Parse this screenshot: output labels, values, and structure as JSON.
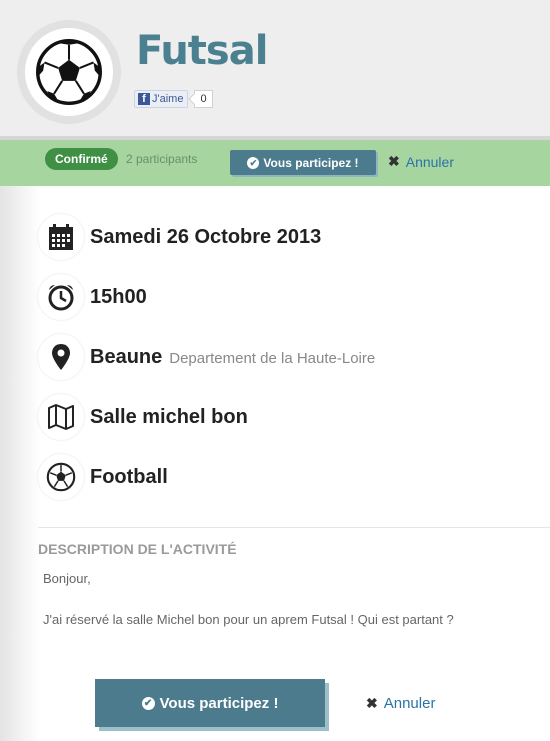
{
  "header": {
    "title": "Futsal",
    "logo_icon": "soccer-ball-icon",
    "facebook": {
      "like_label": "J'aime",
      "like_count": "0"
    }
  },
  "status": {
    "badge": "Confirmé",
    "participants": "2 participants",
    "participate_label": "Vous participez !",
    "cancel_label": "Annuler"
  },
  "details": {
    "date": {
      "icon": "calendar-icon",
      "text": "Samedi 26 Octobre 2013"
    },
    "time": {
      "icon": "alarm-clock-icon",
      "text": "15h00"
    },
    "location": {
      "icon": "map-pin-icon",
      "city": "Beaune",
      "region": "Departement de la Haute-Loire"
    },
    "venue": {
      "icon": "map-icon",
      "text": "Salle michel bon"
    },
    "sport": {
      "icon": "soccer-ball-icon",
      "text": "Football"
    }
  },
  "description": {
    "title": "DESCRIPTION DE L'ACTIVITÉ",
    "paragraphs": [
      "Bonjour,",
      "J'ai réservé la salle Michel bon pour un aprem Futsal ! Qui est partant ?"
    ]
  },
  "footer": {
    "participate_label": "Vous participez !",
    "cancel_label": "Annuler"
  },
  "colors": {
    "accent": "#4b7b8c",
    "status_bar": "#a6d5a0",
    "badge": "#3f8f45",
    "link": "#2a73a6",
    "title": "#4a8090"
  }
}
